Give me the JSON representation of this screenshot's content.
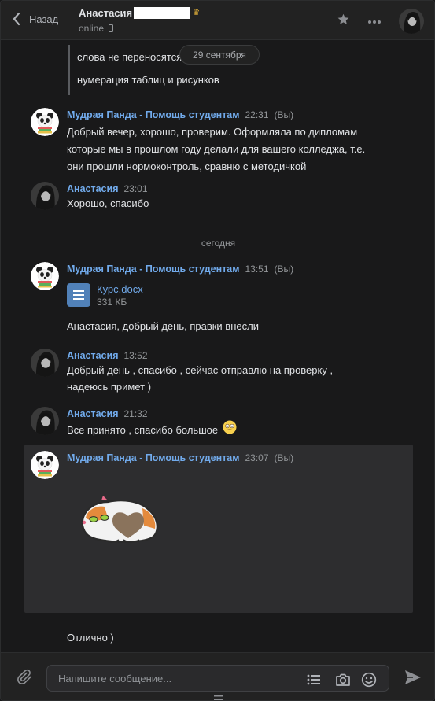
{
  "header": {
    "back_label": "Назад",
    "peer_name": "Анастасия",
    "status": "online",
    "icons": [
      "back-chevron-icon",
      "star-icon",
      "more-icon",
      "phone-icon",
      "crown-icon"
    ]
  },
  "forwarded": {
    "lines": [
      "слова не переносятся",
      "нумерация таблиц и рисунков"
    ]
  },
  "dates": {
    "floating": "29 сентября",
    "today": "сегодня"
  },
  "messages": [
    {
      "author": "Мудрая Панда - Помощь студентам",
      "time": "22:31",
      "mark": "(Вы)",
      "lines": [
        "Добрый вечер, хорошо, проверим. Оформляла по дипломам",
        "которые мы в прошлом году делали для вашего колледжа, т.е.",
        "они прошли нормоконтроль, сравню с методичкой"
      ]
    },
    {
      "author": "Анастасия",
      "time": "23:01",
      "lines": [
        "Хорошо, спасибо"
      ]
    },
    {
      "author": "Мудрая Панда - Помощь студентам",
      "time": "13:51",
      "mark": "(Вы)",
      "doc": {
        "name": "Курс.docx",
        "size": "331 КБ"
      },
      "lines": [
        "Анастасия, добрый день, правки внесли"
      ]
    },
    {
      "author": "Анастасия",
      "time": "13:52",
      "lines": [
        "Добрый день , спасибо , сейчас отправлю на проверку ,",
        "надеюсь примет )"
      ]
    },
    {
      "author": "Анастасия",
      "time": "21:32",
      "lines": [
        "Все принято , спасибо большое"
      ]
    },
    {
      "author": "Мудрая Панда - Помощь студентам",
      "time": "23:07",
      "mark": "(Вы)",
      "sticker": "cat-sticker",
      "lines": [
        "Отлично )"
      ]
    }
  ],
  "composer": {
    "placeholder": "Напишите сообщение...",
    "icons": [
      "attach-icon",
      "list-icon",
      "camera-icon",
      "smile-icon",
      "send-icon"
    ]
  },
  "colors": {
    "background": "#19191a",
    "panel": "#222222",
    "accent_link": "#71aaeb",
    "selected_message": "#2d2d2f",
    "doc_icon": "#5181b8"
  }
}
